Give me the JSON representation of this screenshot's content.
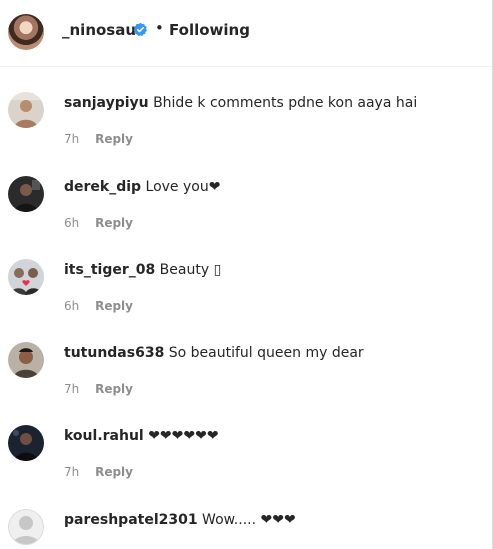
{
  "header": {
    "username": "_ninosaur",
    "separator": "•",
    "follow_status": "Following"
  },
  "comments": [
    {
      "username": "sanjaypiyu",
      "text": "Bhide k comments pdne kon aaya hai",
      "time": "7h",
      "reply_label": "Reply"
    },
    {
      "username": "derek_dip",
      "text": "Love you❤",
      "time": "6h",
      "reply_label": "Reply"
    },
    {
      "username": "its_tiger_08",
      "text": "Beauty ▯",
      "time": "6h",
      "reply_label": "Reply"
    },
    {
      "username": "tutundas638",
      "text": "So beautiful queen my dear",
      "time": "7h",
      "reply_label": "Reply"
    },
    {
      "username": "koul.rahul",
      "text": "❤❤❤❤❤❤",
      "time": "7h",
      "reply_label": "Reply"
    },
    {
      "username": "pareshpatel2301",
      "text": "Wow..... ❤❤❤"
    }
  ],
  "colors": {
    "verified": "#3897f0",
    "muted": "#8e8e8e",
    "text": "#262626"
  }
}
